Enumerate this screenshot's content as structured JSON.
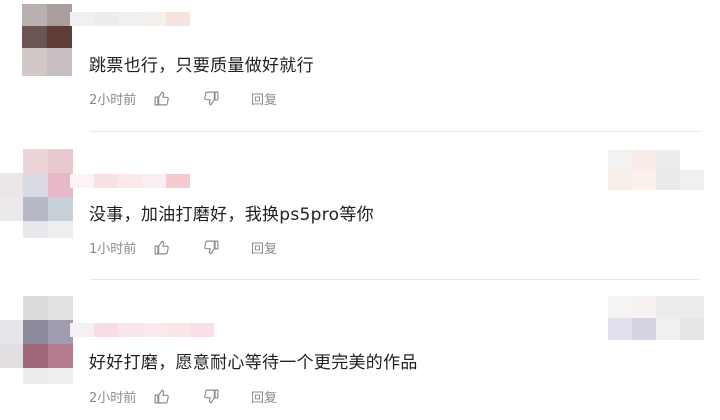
{
  "comments": [
    {
      "text": "跳票也行，只要质量做好就行",
      "time": "2小时前",
      "reply_label": "回复",
      "like_icon": "thumbs-up-icon",
      "dislike_icon": "thumbs-down-icon"
    },
    {
      "text": "没事，加油打磨好，我换ps5pro等你",
      "time": "1小时前",
      "reply_label": "回复",
      "like_icon": "thumbs-up-icon",
      "dislike_icon": "thumbs-down-icon"
    },
    {
      "text": "好好打磨，愿意耐心等待一个更完美的作品",
      "time": "2小时前",
      "reply_label": "回复",
      "like_icon": "thumbs-up-icon",
      "dislike_icon": "thumbs-down-icon"
    }
  ],
  "colors": {
    "text": "#1f1f1f",
    "meta": "#8a8a8a",
    "divider": "#e6e6e6"
  }
}
